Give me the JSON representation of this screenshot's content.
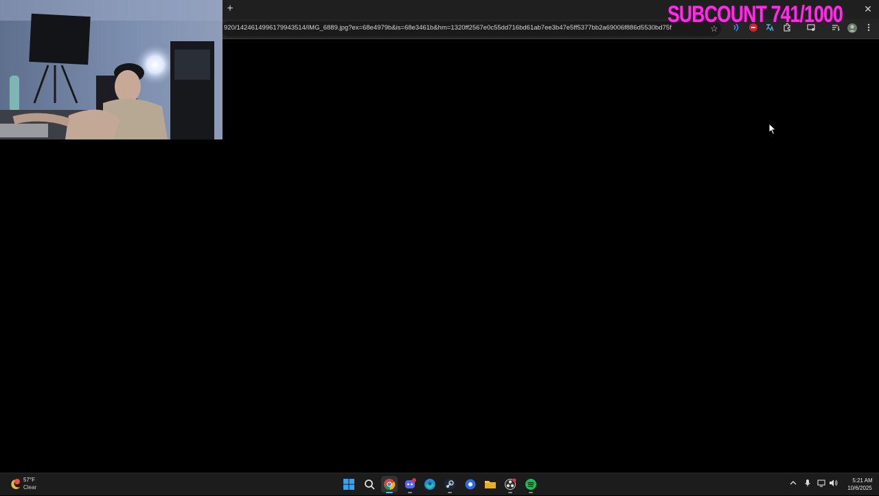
{
  "browser": {
    "new_tab_glyph": "+",
    "close_glyph": "✕",
    "url": "920/1424614996179943514/IMG_6889.jpg?ex=68e4979b&is=68e3461b&hm=1320ff2567e0c55dd716bd61ab7ee3b47e5ff5377bb2a69006f886d5530bd75f",
    "bookmark_glyph": "☆",
    "toolbar_icons": [
      "read-aloud-icon",
      "ublock-icon",
      "translate-icon",
      "extensions-icon",
      "screencast-icon",
      "reading-list-icon",
      "profile-icon",
      "more-menu-icon"
    ]
  },
  "overlay": {
    "subcount": "SUBCOUNT 741/1000"
  },
  "taskbar": {
    "weather_temp": "57°F",
    "weather_condition": "Clear",
    "apps": [
      {
        "name": "start",
        "icon": "windows-start-icon",
        "active": false
      },
      {
        "name": "search",
        "icon": "search-icon",
        "active": false
      },
      {
        "name": "chrome",
        "icon": "chrome-icon",
        "active": true
      },
      {
        "name": "discord",
        "icon": "discord-icon",
        "active": false
      },
      {
        "name": "edge",
        "icon": "edge-icon",
        "active": false
      },
      {
        "name": "steam",
        "icon": "steam-icon",
        "active": false
      },
      {
        "name": "app",
        "icon": "app-icon",
        "active": false
      },
      {
        "name": "file-explorer",
        "icon": "folder-icon",
        "active": false
      },
      {
        "name": "obs",
        "icon": "obs-icon",
        "active": false
      },
      {
        "name": "spotify",
        "icon": "spotify-icon",
        "active": false
      }
    ],
    "clock_time": "5:21 AM",
    "clock_date": "10/6/2025"
  },
  "colors": {
    "subcount": "#ff2ee6",
    "taskbar_bg": "#1c1c1c",
    "active_indicator": "#5ab0ff"
  }
}
